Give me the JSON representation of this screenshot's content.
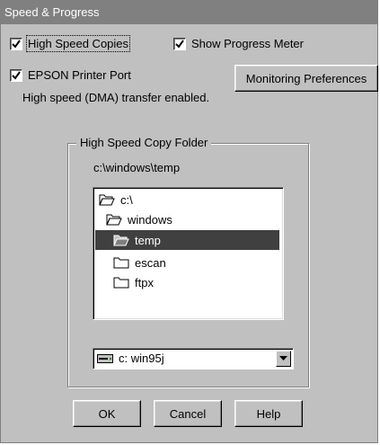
{
  "window": {
    "title": "Speed & Progress"
  },
  "options": {
    "high_speed_copies": {
      "label": "High Speed Copies",
      "checked": true
    },
    "show_progress_meter": {
      "label": "Show Progress Meter",
      "checked": true
    },
    "epson_printer_port": {
      "label": "EPSON Printer Port",
      "checked": true
    }
  },
  "monitoring_button": {
    "label": "Monitoring Preferences"
  },
  "status_text": "High speed (DMA) transfer enabled.",
  "folder_group": {
    "title": "High Speed Copy Folder",
    "current_path": "c:\\windows\\temp",
    "tree": [
      {
        "label": "c:\\",
        "icon": "open-folder-icon",
        "selected": false
      },
      {
        "label": "windows",
        "icon": "open-folder-icon",
        "selected": false
      },
      {
        "label": "temp",
        "icon": "open-folder-icon",
        "selected": true
      },
      {
        "label": "escan",
        "icon": "folder-icon",
        "selected": false
      },
      {
        "label": "ftpx",
        "icon": "folder-icon",
        "selected": false
      }
    ],
    "drive": {
      "label": "c:  win95j",
      "icon": "drive-icon"
    }
  },
  "buttons": {
    "ok": "OK",
    "cancel": "Cancel",
    "help": "Help"
  },
  "colors": {
    "face": "#c0c0c0",
    "title_bar": "#808080",
    "selection": "#404040"
  }
}
